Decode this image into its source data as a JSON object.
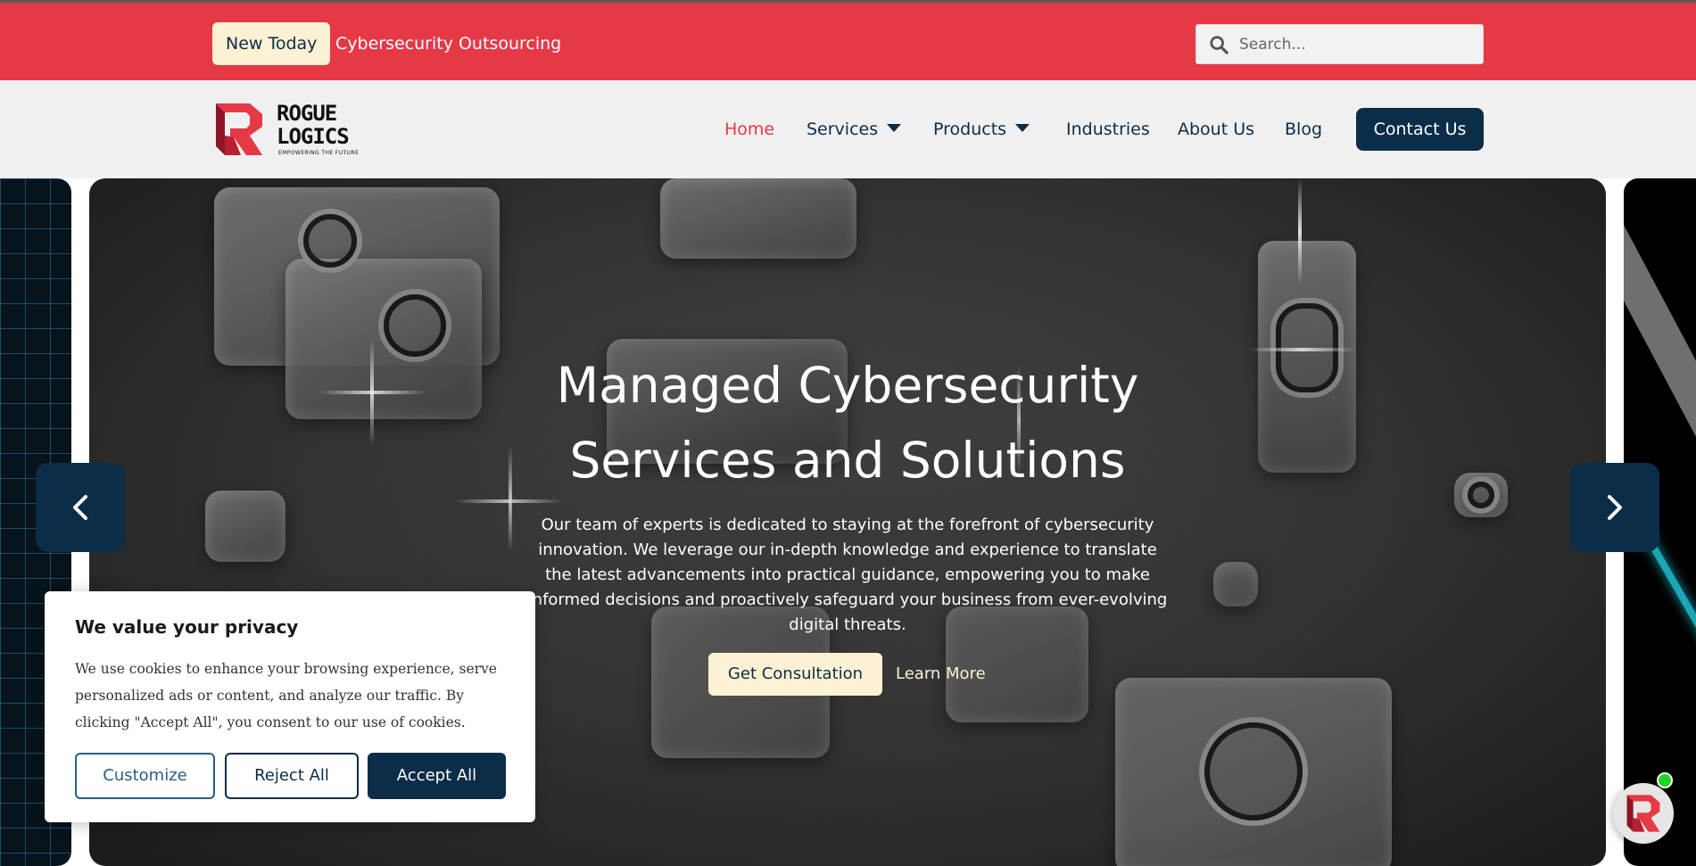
{
  "topbar": {
    "badge": "New Today",
    "announcement": "Cybersecurity Outsourcing",
    "search_placeholder": "Search..."
  },
  "logo": {
    "line1": "ROGUE",
    "line2": "LOGICS",
    "tagline": "EMPOWERING THE FUTURE"
  },
  "nav": {
    "items": [
      {
        "label": "Home",
        "active": true
      },
      {
        "label": "Services",
        "dropdown": true
      },
      {
        "label": "Products",
        "dropdown": true
      },
      {
        "label": "Industries"
      },
      {
        "label": "About Us"
      },
      {
        "label": "Blog"
      }
    ],
    "cta": "Contact Us"
  },
  "hero": {
    "title_line1": "Managed Cybersecurity",
    "title_line2": "Services and Solutions",
    "description": "Our team of experts is dedicated to staying at the forefront of cybersecurity innovation. We leverage our in-depth knowledge and experience to translate the latest advancements into practical guidance, empowering you to make informed decisions and proactively safeguard your business from ever-evolving digital threats.",
    "primary_button": "Get Consultation",
    "secondary_button": "Learn More"
  },
  "cookie": {
    "title": "We value your privacy",
    "text": "We use cookies to enhance your browsing experience, serve personalized ads or content, and analyze our traffic. By clicking \"Accept All\", you consent to our use of cookies.",
    "customize": "Customize",
    "reject": "Reject All",
    "accept": "Accept All"
  },
  "colors": {
    "brand_red": "#e63946",
    "navy": "#0b2d48",
    "cream": "#fdf1d3",
    "online_green": "#1fd41f"
  },
  "icons": [
    "search-icon",
    "caret-down-icon",
    "chevron-left-icon",
    "chevron-right-icon",
    "logo-r-icon",
    "chat-icon"
  ]
}
